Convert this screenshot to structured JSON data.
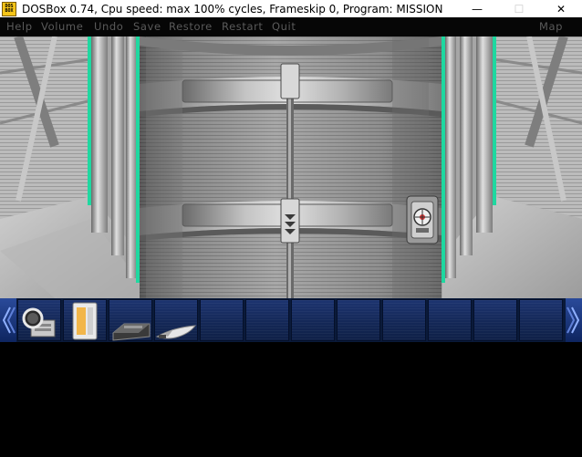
{
  "window": {
    "title": "DOSBox 0.74, Cpu speed: max 100% cycles, Frameskip  0, Program:  MISSION",
    "icon_text_top": "DOS",
    "icon_text_bottom": "BOX",
    "minimize_glyph": "—",
    "maximize_glyph": "☐",
    "close_glyph": "✕"
  },
  "menu": {
    "help": "Help",
    "volume": "Volume",
    "undo": "Undo",
    "save": "Save",
    "restore": "Restore",
    "restart": "Restart",
    "quit": "Quit",
    "map": "Map"
  },
  "inventory": {
    "left_arrow_icon": "scroll-left-icon",
    "right_arrow_icon": "scroll-right-icon",
    "items": [
      "magnifier-item",
      "id-card-item",
      "device-item",
      "wing-item"
    ],
    "empty_slots": 8
  },
  "colors": {
    "menu_text": "#5a5a5a",
    "inventory_bg": "#142857",
    "arrow_blue": "#2a4a9a",
    "glow_green": "#1fd8a0"
  }
}
